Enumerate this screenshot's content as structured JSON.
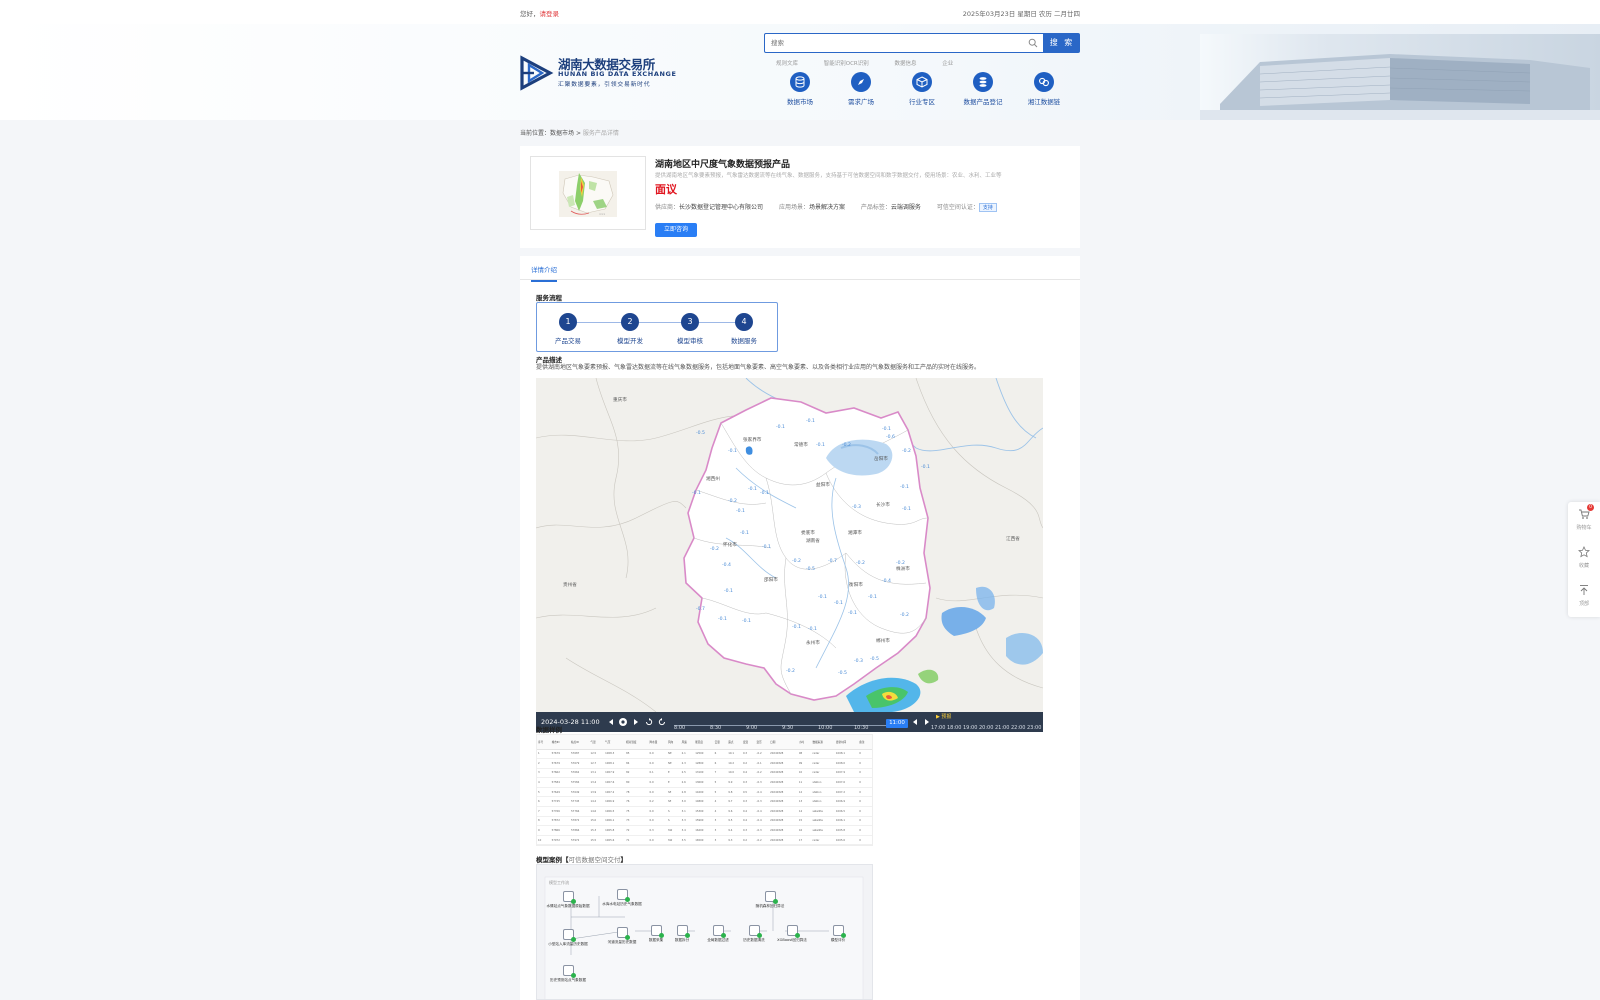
{
  "topbar": {
    "greeting": "您好，",
    "login_link": "请登录",
    "date": "2025年03月23日 星期日 农历 二月廿四"
  },
  "brand": {
    "name_cn": "湖南大数据交易所",
    "name_en": "HUNAN BIG DATA EXCHANGE",
    "slogan": "汇聚数据要素，引领交易新时代",
    "primary_color": "#1d3f7d",
    "accent_color": "#2a67c7"
  },
  "search": {
    "placeholder": "搜索",
    "button_label": "搜 索",
    "hot_links": [
      "规则文库",
      "智能识别OCR识别",
      "数据信息",
      "企业"
    ]
  },
  "nav": [
    {
      "label": "数据市场",
      "icon": "database-icon"
    },
    {
      "label": "需求广场",
      "icon": "compass-icon"
    },
    {
      "label": "行业专区",
      "icon": "cube-icon"
    },
    {
      "label": "数据产品登记",
      "icon": "register-icon"
    },
    {
      "label": "湘江数据链",
      "icon": "chain-icon"
    }
  ],
  "breadcrumb": {
    "prefix": "当前位置：",
    "level1": "数据市场",
    "separator": " > ",
    "current": "服务产品详情"
  },
  "product": {
    "title": "湖南地区中尺度气象数据预报产品",
    "description": "提供湖南地区气象要素预报，气象雷达数据流等在线气象、数据服务，支持基于可信数据空间和数字数据交付，使用场景：农业、水利、工业等",
    "price": "面议",
    "meta": {
      "supplier_label": "供应商：",
      "supplier": "长沙数据登记管理中心有限公司",
      "scene_label": "应用场景：",
      "scene": "场景解决方案",
      "type_label": "产品标签：",
      "type": "云端调服务",
      "trust_label": "可信空间认证：",
      "trust_tag": "支持"
    },
    "buy_button": "立即咨询"
  },
  "tabs": [
    {
      "label": "详情介绍",
      "active": true
    }
  ],
  "service_flow": {
    "heading": "服务流程",
    "steps": [
      {
        "num": "1",
        "label": "产品交易"
      },
      {
        "num": "2",
        "label": "模型开发"
      },
      {
        "num": "3",
        "label": "模型审核"
      },
      {
        "num": "4",
        "label": "数据服务"
      }
    ]
  },
  "product_desc": {
    "heading": "产品描述",
    "text": "提供湖南地区气象要素预报、气象雷达数据流等在线气象数据服务，包括地面气象要素、高空气象要素、以及各类相行业应用的气象数据服务和工产品的实时在线服务。"
  },
  "map": {
    "timestamp": "2024-03-28 11:00",
    "now_label": "11:00",
    "forecast_label": "▶ 预报",
    "time_ticks": [
      "8:00",
      "8:30",
      "9:00",
      "9:30",
      "10:00",
      "10:30",
      "17:00",
      "18:00",
      "19:00",
      "20:00",
      "21:00",
      "22:00",
      "23:00"
    ],
    "labels": [
      "重庆市",
      "张家界市",
      "常德市",
      "岳阳市",
      "益阳市",
      "长沙市",
      "湘潭市",
      "娄底市",
      "怀化市",
      "邵阳市",
      "衡阳市",
      "永州市",
      "郴州市",
      "株洲市",
      "湘西州",
      "贵州省",
      "江西省",
      "湖南省"
    ],
    "values": [
      "-0.1",
      "-0.2",
      "0.1",
      "0.5",
      "-0.1",
      "-0.7",
      "-0.1",
      "0.2",
      "-0.1",
      "-0.1",
      "-0.2",
      "-0.3"
    ]
  },
  "data_sample": {
    "heading": "数据样例",
    "columns": [
      "序号",
      "城市ID",
      "站点ID",
      "气温",
      "气压",
      "相对湿度",
      "降水量",
      "风向",
      "风速",
      "能见度",
      "云量",
      "露点",
      "变温",
      "变压",
      "日期",
      "小时",
      "数据来源",
      "更新时间",
      "备注"
    ],
    "rows": [
      [
        "1",
        "57679",
        "57687",
        "12.5",
        "1008.3",
        "85",
        "0.0",
        "NE",
        "2.1",
        "12500",
        "6",
        "10.1",
        "0.3",
        "-0.2",
        "20240328",
        "08",
        "radar",
        "1008.1",
        "0"
      ],
      [
        "2",
        "57679",
        "57679",
        "12.7",
        "1008.1",
        "84",
        "0.0",
        "NE",
        "2.3",
        "12800",
        "6",
        "10.2",
        "0.2",
        "-0.1",
        "20240328",
        "09",
        "radar",
        "1008.0",
        "0"
      ],
      [
        "3",
        "57662",
        "57662",
        "13.1",
        "1007.9",
        "82",
        "0.1",
        "E",
        "2.5",
        "13100",
        "7",
        "10.0",
        "0.4",
        "-0.2",
        "20240328",
        "10",
        "radar",
        "1007.9",
        "0"
      ],
      [
        "4",
        "57584",
        "57584",
        "13.4",
        "1007.6",
        "80",
        "0.0",
        "E",
        "2.6",
        "13600",
        "5",
        "9.9",
        "0.3",
        "-0.3",
        "20240328",
        "11",
        "station",
        "1007.6",
        "0"
      ],
      [
        "5",
        "57649",
        "57649",
        "13.9",
        "1007.2",
        "78",
        "0.0",
        "SE",
        "2.8",
        "14200",
        "5",
        "9.8",
        "0.5",
        "-0.4",
        "20240328",
        "12",
        "station",
        "1007.2",
        "0"
      ],
      [
        "6",
        "57745",
        "57745",
        "14.2",
        "1006.9",
        "76",
        "0.2",
        "SE",
        "3.0",
        "14800",
        "4",
        "9.7",
        "0.3",
        "-0.3",
        "20240328",
        "13",
        "station",
        "1006.9",
        "0"
      ],
      [
        "7",
        "57766",
        "57766",
        "14.6",
        "1006.5",
        "75",
        "0.0",
        "S",
        "3.1",
        "15300",
        "4",
        "9.6",
        "0.4",
        "-0.4",
        "20240328",
        "14",
        "satellite",
        "1006.5",
        "0"
      ],
      [
        "8",
        "57872",
        "57872",
        "15.0",
        "1006.1",
        "73",
        "0.0",
        "S",
        "3.3",
        "15900",
        "3",
        "9.5",
        "0.4",
        "-0.4",
        "20240328",
        "15",
        "satellite",
        "1006.1",
        "0"
      ],
      [
        "9",
        "57866",
        "57866",
        "15.3",
        "1005.8",
        "72",
        "0.3",
        "SW",
        "3.4",
        "16200",
        "3",
        "9.4",
        "0.3",
        "-0.3",
        "20240328",
        "16",
        "satellite",
        "1005.8",
        "0"
      ],
      [
        "10",
        "57972",
        "57972",
        "15.5",
        "1005.6",
        "71",
        "0.0",
        "SW",
        "3.5",
        "16500",
        "3",
        "9.3",
        "0.2",
        "-0.2",
        "20240328",
        "17",
        "radar",
        "1005.6",
        "0"
      ]
    ]
  },
  "model_case": {
    "heading_bold": "模型案例【",
    "heading_mid": "可信数据空间交付",
    "heading_end": "】",
    "nodes": [
      "水情站点气象数据原始数据",
      "水库水电站历史气象数据",
      "小型站入库流量历史数据",
      "历史预测站点气象数据",
      "数据拆分",
      "数据采集",
      "全局数据过滤",
      "历史数据清洗",
      "XGBoost回归算法",
      "随机森林回归算法",
      "模型评价",
      "河道流量历史数据"
    ]
  },
  "sidetools": [
    {
      "label": "购物车",
      "badge": "0"
    },
    {
      "label": "收藏"
    },
    {
      "label": "顶部"
    }
  ]
}
